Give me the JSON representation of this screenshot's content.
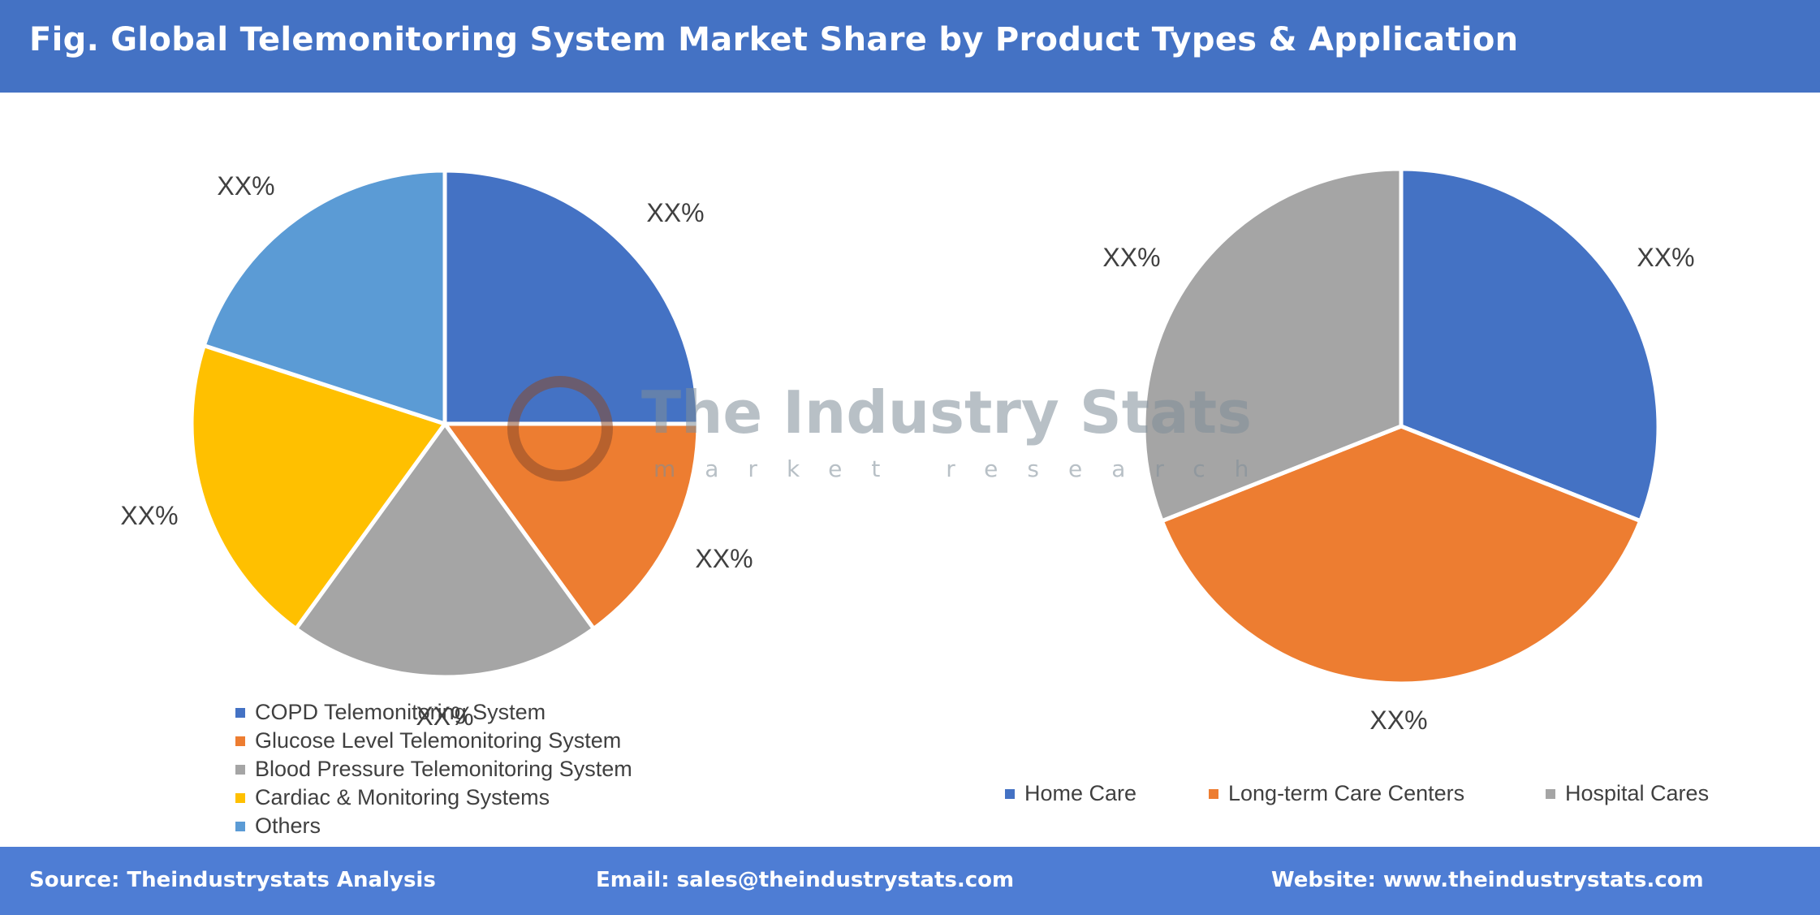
{
  "title": "Fig. Global Telemonitoring System Market Share by Product Types & Application",
  "footer": {
    "source": "Source: Theindustrystats Analysis",
    "email": "Email: sales@theindustrystats.com",
    "website": "Website: www.theindustrystats.com"
  },
  "watermark": {
    "name": "The Industry Stats",
    "tagline": "market research"
  },
  "chart_data": [
    {
      "type": "pie",
      "title": "",
      "legend_position": "bottom",
      "categories": [
        "COPD Telemonitoring System",
        "Glucose Level Telemonitoring System",
        "Blood Pressure Telemonitoring System",
        "Cardiac & Monitoring Systems",
        "Others"
      ],
      "values": [
        25,
        15,
        20,
        20,
        20
      ],
      "data_labels": [
        "XX%",
        "XX%",
        "XX%",
        "XX%",
        "XX%"
      ],
      "colors": [
        "#4472c4",
        "#ed7d31",
        "#a5a5a5",
        "#ffc000",
        "#5b9bd5"
      ]
    },
    {
      "type": "pie",
      "title": "",
      "legend_position": "bottom",
      "categories": [
        "Home Care",
        "Long-term Care Centers",
        "Hospital Cares"
      ],
      "values": [
        31,
        38,
        31
      ],
      "data_labels": [
        "XX%",
        "XX%",
        "XX%"
      ],
      "colors": [
        "#4472c4",
        "#ed7d31",
        "#a5a5a5"
      ]
    }
  ]
}
